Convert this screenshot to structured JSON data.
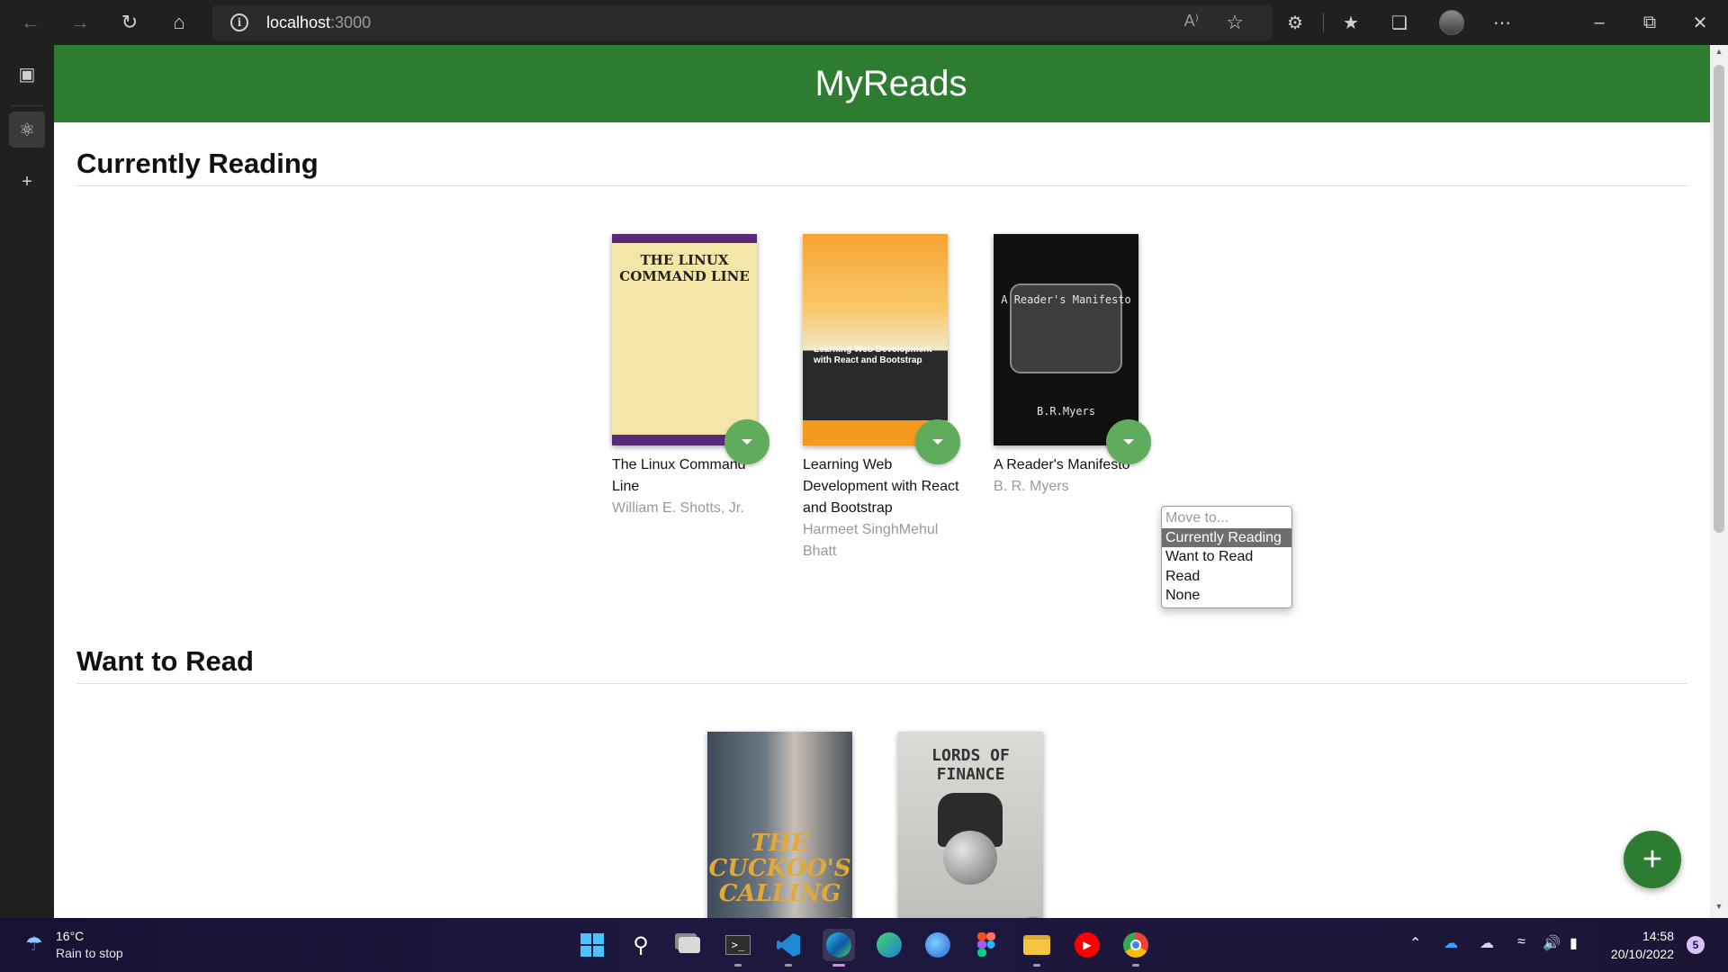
{
  "browser": {
    "url_host": "localhost",
    "url_port": ":3000",
    "read_aloud_label": "A⁾"
  },
  "app": {
    "title": "MyReads"
  },
  "shelves": [
    {
      "title": "Currently Reading",
      "books": [
        {
          "title": "The Linux Command Line",
          "author": "William E. Shotts, Jr.",
          "cover_text": "THE LINUX COMMAND LINE"
        },
        {
          "title": "Learning Web Development with React and Bootstrap",
          "author": "Harmeet SinghMehul Bhatt",
          "cover_text": "Learning Web Development with React and Bootstrap"
        },
        {
          "title": "A Reader's Manifesto",
          "author": "B. R. Myers",
          "cover_text": "A Reader's Manifesto",
          "cover_author": "B.R.Myers"
        }
      ]
    },
    {
      "title": "Want to Read",
      "books": [
        {
          "title": "",
          "author": "",
          "cover_text": "THE CUCKOO'S CALLING"
        },
        {
          "title": "",
          "author": "",
          "cover_text": "LORDS OF FINANCE"
        }
      ]
    }
  ],
  "shelf_menu": {
    "options": [
      "Move to...",
      "Currently Reading",
      "Want to Read",
      "Read",
      "None"
    ],
    "selected": "Currently Reading"
  },
  "fab": {
    "label": "+"
  },
  "taskbar": {
    "weather_temp": "16°C",
    "weather_desc": "Rain to stop",
    "time": "14:58",
    "date": "20/10/2022",
    "notification_count": "5"
  },
  "colors": {
    "header_green": "#2e7c31",
    "changer_green": "#60ac5d",
    "author_gray": "#999999"
  }
}
